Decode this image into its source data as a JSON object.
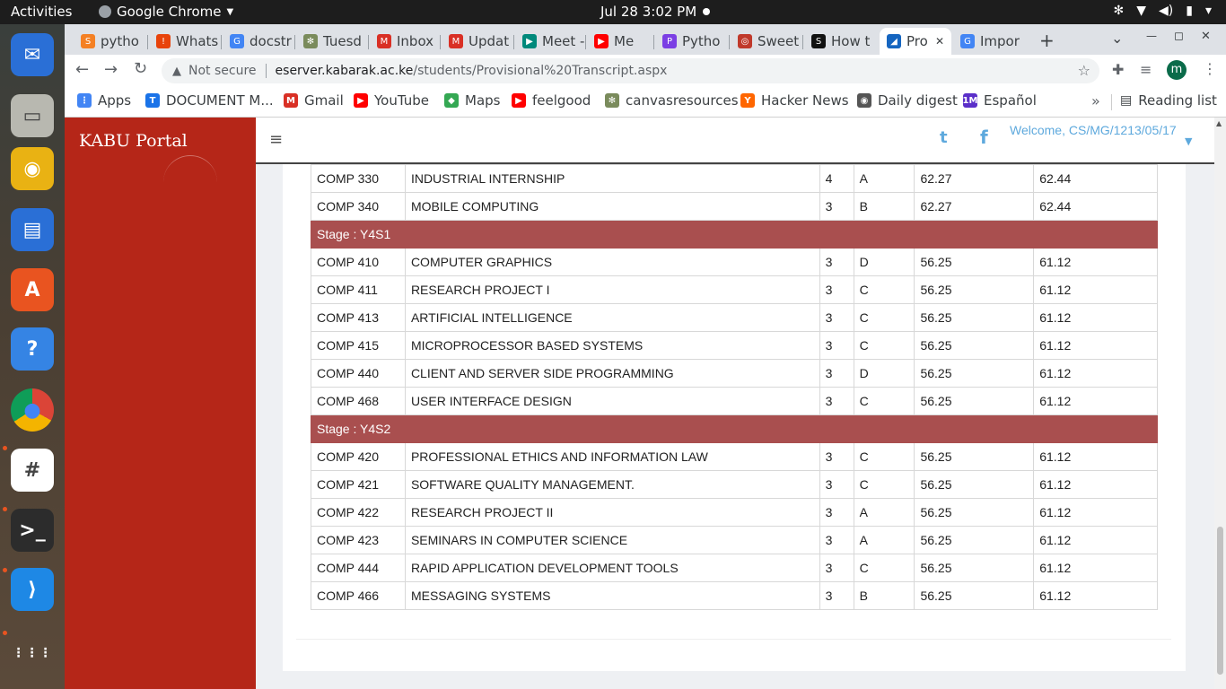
{
  "topbar": {
    "activities": "Activities",
    "app_name": "Google Chrome",
    "clock": "Jul 28  3:02 PM"
  },
  "tabs": [
    {
      "label": "pytho",
      "color": "#f48024",
      "glyph": "S"
    },
    {
      "label": "Whats",
      "color": "#e8430b",
      "glyph": "!"
    },
    {
      "label": "docstr",
      "color": "#4285f4",
      "glyph": "G"
    },
    {
      "label": "Tuesd",
      "color": "#7a8b5c",
      "glyph": "✻"
    },
    {
      "label": "Inbox",
      "color": "#d93025",
      "glyph": "M"
    },
    {
      "label": "Updat",
      "color": "#d93025",
      "glyph": "M"
    },
    {
      "label": "Meet -",
      "color": "#00897b",
      "glyph": "▶"
    },
    {
      "label": "Me",
      "color": "#ff0000",
      "glyph": "▶"
    },
    {
      "label": "Pytho",
      "color": "#7b3fe4",
      "glyph": "P"
    },
    {
      "label": "Sweet",
      "color": "#c0392b",
      "glyph": "◎"
    },
    {
      "label": "How t",
      "color": "#111111",
      "glyph": "S"
    },
    {
      "label": "Pro",
      "color": "#1565c0",
      "glyph": "◢",
      "active": true
    },
    {
      "label": "Impor",
      "color": "#4285f4",
      "glyph": "G"
    }
  ],
  "omnibox": {
    "security": "Not secure",
    "host": "eserver.kabarak.ac.ke",
    "path": "/students/Provisional%20Transcript.aspx"
  },
  "profile_initial": "m",
  "bookmarks": [
    {
      "label": "Apps",
      "color": "#4285f4",
      "glyph": "⋮"
    },
    {
      "label": "DOCUMENT M...",
      "color": "#1a73e8",
      "glyph": "T"
    },
    {
      "label": "Gmail",
      "color": "#d93025",
      "glyph": "M"
    },
    {
      "label": "YouTube",
      "color": "#ff0000",
      "glyph": "▶"
    },
    {
      "label": "Maps",
      "color": "#34a853",
      "glyph": "◆"
    },
    {
      "label": "feelgood",
      "color": "#ff0000",
      "glyph": "▶"
    },
    {
      "label": "canvasresources",
      "color": "#7a8b5c",
      "glyph": "✻"
    },
    {
      "label": "Hacker News",
      "color": "#ff6600",
      "glyph": "Y"
    },
    {
      "label": "Daily digest",
      "color": "#555555",
      "glyph": "◉"
    },
    {
      "label": "Español",
      "color": "#5b2fc9",
      "glyph": "1M"
    }
  ],
  "reading_list": "Reading list",
  "portal": {
    "brand": "KABU Portal",
    "welcome": "Welcome, CS/MG/1213/05/17"
  },
  "transcript": {
    "rows": [
      {
        "type": "course",
        "code": "COMP 330",
        "title": "INDUSTRIAL INTERNSHIP",
        "units": "4",
        "grade": "A",
        "mean": "62.27",
        "cum": "62.44"
      },
      {
        "type": "course",
        "code": "COMP 340",
        "title": "MOBILE COMPUTING",
        "units": "3",
        "grade": "B",
        "mean": "62.27",
        "cum": "62.44"
      },
      {
        "type": "stage",
        "label": "Stage : Y4S1"
      },
      {
        "type": "course",
        "code": "COMP 410",
        "title": "COMPUTER GRAPHICS",
        "units": "3",
        "grade": "D",
        "mean": "56.25",
        "cum": "61.12"
      },
      {
        "type": "course",
        "code": "COMP 411",
        "title": "RESEARCH PROJECT I",
        "units": "3",
        "grade": "C",
        "mean": "56.25",
        "cum": "61.12"
      },
      {
        "type": "course",
        "code": "COMP 413",
        "title": "ARTIFICIAL INTELLIGENCE",
        "units": "3",
        "grade": "C",
        "mean": "56.25",
        "cum": "61.12"
      },
      {
        "type": "course",
        "code": "COMP 415",
        "title": "MICROPROCESSOR BASED SYSTEMS",
        "units": "3",
        "grade": "C",
        "mean": "56.25",
        "cum": "61.12"
      },
      {
        "type": "course",
        "code": "COMP 440",
        "title": "CLIENT AND SERVER SIDE PROGRAMMING",
        "units": "3",
        "grade": "D",
        "mean": "56.25",
        "cum": "61.12"
      },
      {
        "type": "course",
        "code": "COMP 468",
        "title": "USER INTERFACE DESIGN",
        "units": "3",
        "grade": "C",
        "mean": "56.25",
        "cum": "61.12"
      },
      {
        "type": "stage",
        "label": "Stage : Y4S2"
      },
      {
        "type": "course",
        "code": "COMP 420",
        "title": "PROFESSIONAL ETHICS AND INFORMATION LAW",
        "units": "3",
        "grade": "C",
        "mean": "56.25",
        "cum": "61.12"
      },
      {
        "type": "course",
        "code": "COMP 421",
        "title": "SOFTWARE QUALITY MANAGEMENT.",
        "units": "3",
        "grade": "C",
        "mean": "56.25",
        "cum": "61.12"
      },
      {
        "type": "course",
        "code": "COMP 422",
        "title": "RESEARCH PROJECT II",
        "units": "3",
        "grade": "A",
        "mean": "56.25",
        "cum": "61.12"
      },
      {
        "type": "course",
        "code": "COMP 423",
        "title": "SEMINARS IN COMPUTER SCIENCE",
        "units": "3",
        "grade": "A",
        "mean": "56.25",
        "cum": "61.12"
      },
      {
        "type": "course",
        "code": "COMP 444",
        "title": "RAPID APPLICATION DEVELOPMENT TOOLS",
        "units": "3",
        "grade": "C",
        "mean": "56.25",
        "cum": "61.12"
      },
      {
        "type": "course",
        "code": "COMP 466",
        "title": "MESSAGING SYSTEMS",
        "units": "3",
        "grade": "B",
        "mean": "56.25",
        "cum": "61.12"
      }
    ]
  },
  "dock": [
    {
      "name": "thunderbird-icon",
      "color": "#2a6fd6",
      "glyph": "✉"
    },
    {
      "name": "files-icon",
      "color": "#b8b8b0",
      "glyph": "▭"
    },
    {
      "name": "rhythmbox-icon",
      "color": "#e9b213",
      "glyph": "◉"
    },
    {
      "name": "libreoffice-writer-icon",
      "color": "#2a6fd6",
      "glyph": "▤"
    },
    {
      "name": "software-center-icon",
      "color": "#e95420",
      "glyph": "A"
    },
    {
      "name": "help-icon",
      "color": "#3584e4",
      "glyph": "?"
    },
    {
      "name": "chrome-icon",
      "color": "#ffffff",
      "glyph": "●"
    },
    {
      "name": "slack-icon",
      "color": "#ffffff",
      "glyph": "#"
    },
    {
      "name": "terminal-icon",
      "color": "#2c2c2c",
      "glyph": ">_"
    },
    {
      "name": "vscode-icon",
      "color": "#1e88e5",
      "glyph": "⟩"
    },
    {
      "name": "show-apps-icon",
      "color": "transparent",
      "glyph": "⋮⋮⋮"
    }
  ]
}
